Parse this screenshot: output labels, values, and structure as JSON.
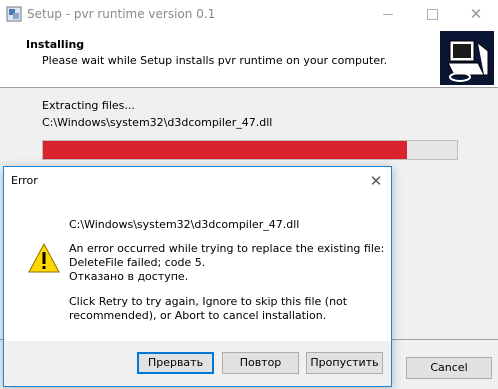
{
  "setup": {
    "title": "Setup - pvr runtime version 0.1",
    "header_title": "Installing",
    "header_subtitle": "Please wait while Setup installs pvr runtime on your computer.",
    "status_label": "Extracting files...",
    "current_file": "C:\\Windows\\system32\\d3dcompiler_47.dll",
    "progress_fraction": 0.88,
    "cancel_label": "Cancel",
    "progress_color": "#d9232e"
  },
  "error_dialog": {
    "title": "Error",
    "file_path": "C:\\Windows\\system32\\d3dcompiler_47.dll",
    "message_lines": [
      "An error occurred while trying to replace the existing file:",
      "DeleteFile failed; code 5.",
      "Отказано в доступе.",
      "",
      "Click Retry to try again, Ignore to skip this file (not",
      "recommended), or Abort to cancel installation."
    ],
    "buttons": {
      "abort": "Прервать",
      "retry": "Повтор",
      "ignore": "Пропустить"
    },
    "icon": "warning-icon"
  }
}
